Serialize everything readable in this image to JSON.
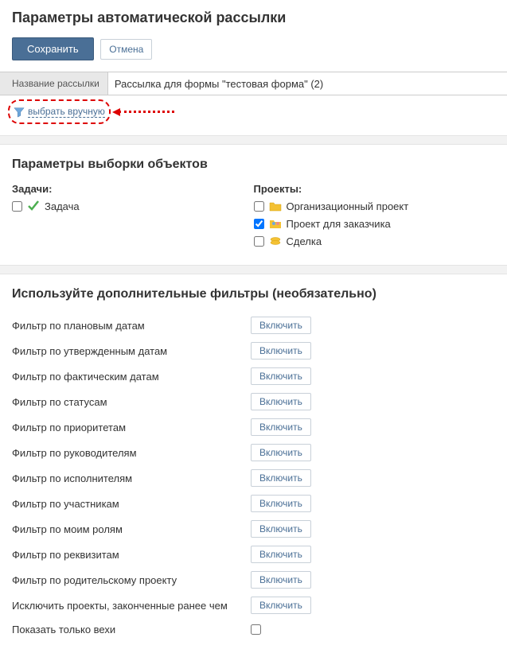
{
  "header": {
    "title": "Параметры автоматической рассылки",
    "save_label": "Сохранить",
    "cancel_label": "Отмена"
  },
  "name_field": {
    "label": "Название рассылки",
    "value": "Рассылка для формы \"тестовая форма\" (2)"
  },
  "manual_select": {
    "label": "выбрать вручную"
  },
  "selection": {
    "title": "Параметры выборки объектов",
    "tasks_title": "Задачи:",
    "projects_title": "Проекты:",
    "tasks": [
      {
        "label": "Задача",
        "checked": false
      }
    ],
    "projects": [
      {
        "label": "Организационный проект",
        "checked": false
      },
      {
        "label": "Проект для заказчика",
        "checked": true
      },
      {
        "label": "Сделка",
        "checked": false
      }
    ]
  },
  "filters": {
    "title": "Используйте дополнительные фильтры (необязательно)",
    "enable_label": "Включить",
    "items": [
      "Фильтр по плановым датам",
      "Фильтр по утвержденным датам",
      "Фильтр по фактическим датам",
      "Фильтр по статусам",
      "Фильтр по приоритетам",
      "Фильтр по руководителям",
      "Фильтр по исполнителям",
      "Фильтр по участникам",
      "Фильтр по моим ролям",
      "Фильтр по реквизитам",
      "Фильтр по родительскому проекту",
      "Исключить проекты, законченные ранее чем"
    ],
    "milestones_only": {
      "label": "Показать только вехи",
      "checked": false
    }
  }
}
